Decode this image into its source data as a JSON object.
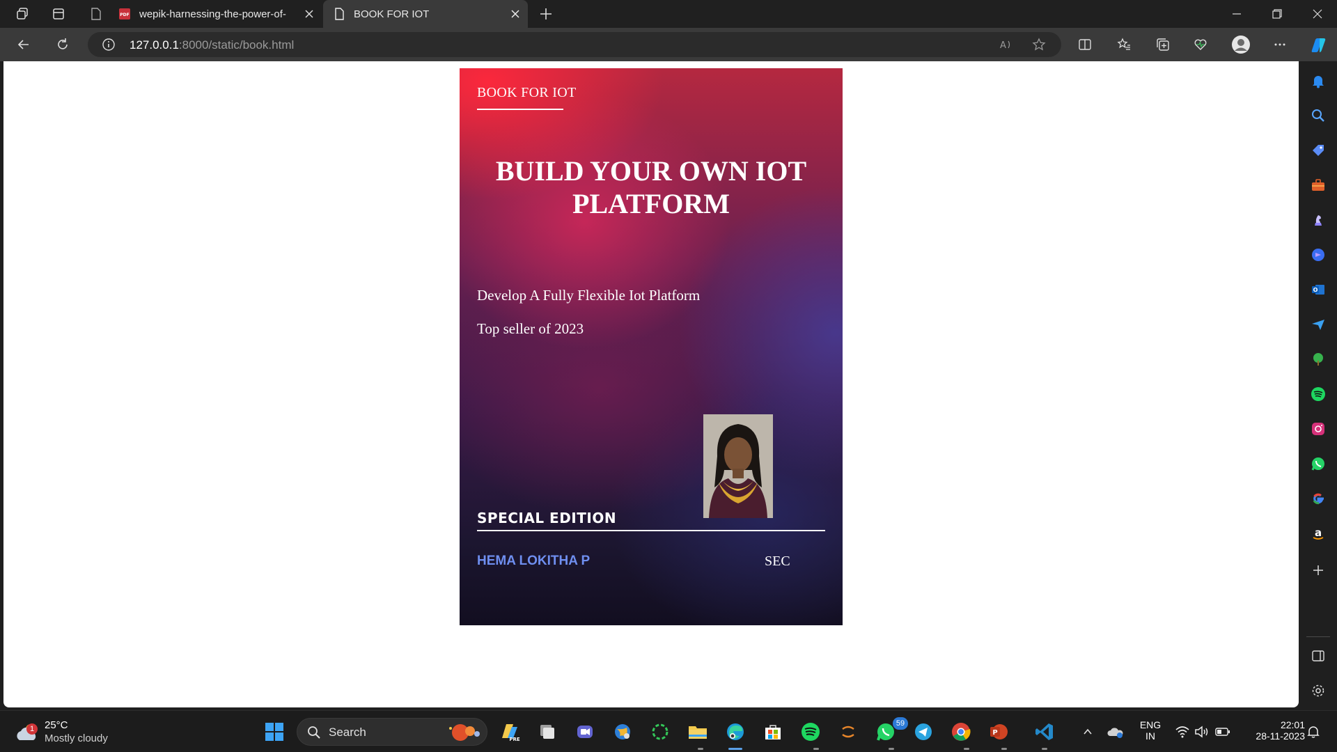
{
  "browser": {
    "tabs": [
      {
        "title": "wepik-harnessing-the-power-of-",
        "icon": "pdf-icon",
        "active": false
      },
      {
        "title": "BOOK FOR IOT",
        "icon": "page-icon",
        "active": true
      }
    ],
    "address": {
      "host": "127.0.0.1",
      "path": ":8000/static/book.html"
    }
  },
  "book": {
    "brand": "BOOK FOR IOT",
    "title_line1": "BUILD YOUR OWN IOT",
    "title_line2": "PLATFORM",
    "subtitle": "Develop A Fully Flexible Iot Platform",
    "tagline": "Top seller of 2023",
    "edition": "SPECIAL EDITION",
    "author": "HEMA LOKITHA P",
    "publisher": "SEC",
    "colors": {
      "author": "#6f8ff0",
      "cover_top": "#e8293c",
      "cover_bottom": "#120e20"
    }
  },
  "sidebar": {
    "icons": [
      "bell-icon",
      "search-icon",
      "tag-icon",
      "briefcase-icon",
      "chess-icon",
      "copilot-icon",
      "outlook-icon",
      "send-icon",
      "tree-icon",
      "spotify-icon",
      "instagram-icon",
      "whatsapp-icon",
      "google-icon",
      "amazon-icon",
      "add-icon",
      "sidebar-toggle-icon",
      "settings-icon"
    ]
  },
  "taskbar": {
    "weather": {
      "temp": "25°C",
      "desc": "Mostly cloudy",
      "badge": "1"
    },
    "search_label": "Search",
    "whatsapp_badge": "59",
    "tray": {
      "lang1": "ENG",
      "lang2": "IN",
      "time": "22:01",
      "date": "28-11-2023"
    }
  }
}
